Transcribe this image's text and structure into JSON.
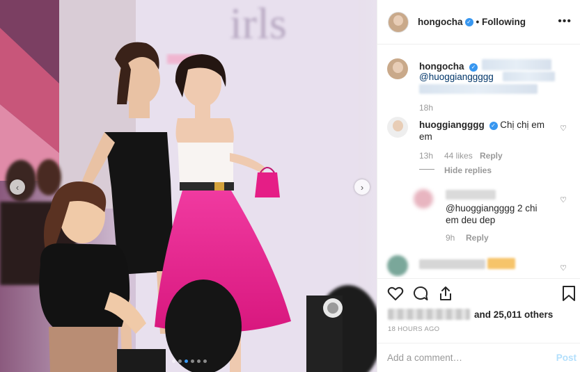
{
  "header": {
    "username": "hongocha",
    "verified_mark": "✓",
    "following": "• Following",
    "more": "•••"
  },
  "caption": {
    "username": "hongocha",
    "mention": "@huoggianggggg",
    "time": "18h"
  },
  "comments": [
    {
      "username": "huoggiangggg",
      "text": "Chị chị em em",
      "time": "13h",
      "likes": "44 likes",
      "reply": "Reply",
      "hide_replies": "Hide replies"
    },
    {
      "username_hidden": true,
      "text": "@huoggiangggg 2 chi em deu dep",
      "time": "9h",
      "reply": "Reply"
    }
  ],
  "photo": {
    "nav_prev": "‹",
    "nav_next": "›",
    "dots_total": 6,
    "dot_active": 3,
    "banner_text": "irls"
  },
  "actions": {
    "icons": [
      "heart-icon",
      "comment-icon",
      "share-icon",
      "bookmark-icon"
    ],
    "likes_suffix": "and 25,011 others",
    "timestamp": "18 HOURS AGO"
  },
  "add_comment": {
    "placeholder": "Add a comment…",
    "post": "Post"
  },
  "colors": {
    "link_blue": "#003569",
    "verified_blue": "#3897f0",
    "post_disabled": "#b2dffc",
    "dress_pink": "#e2238e"
  }
}
